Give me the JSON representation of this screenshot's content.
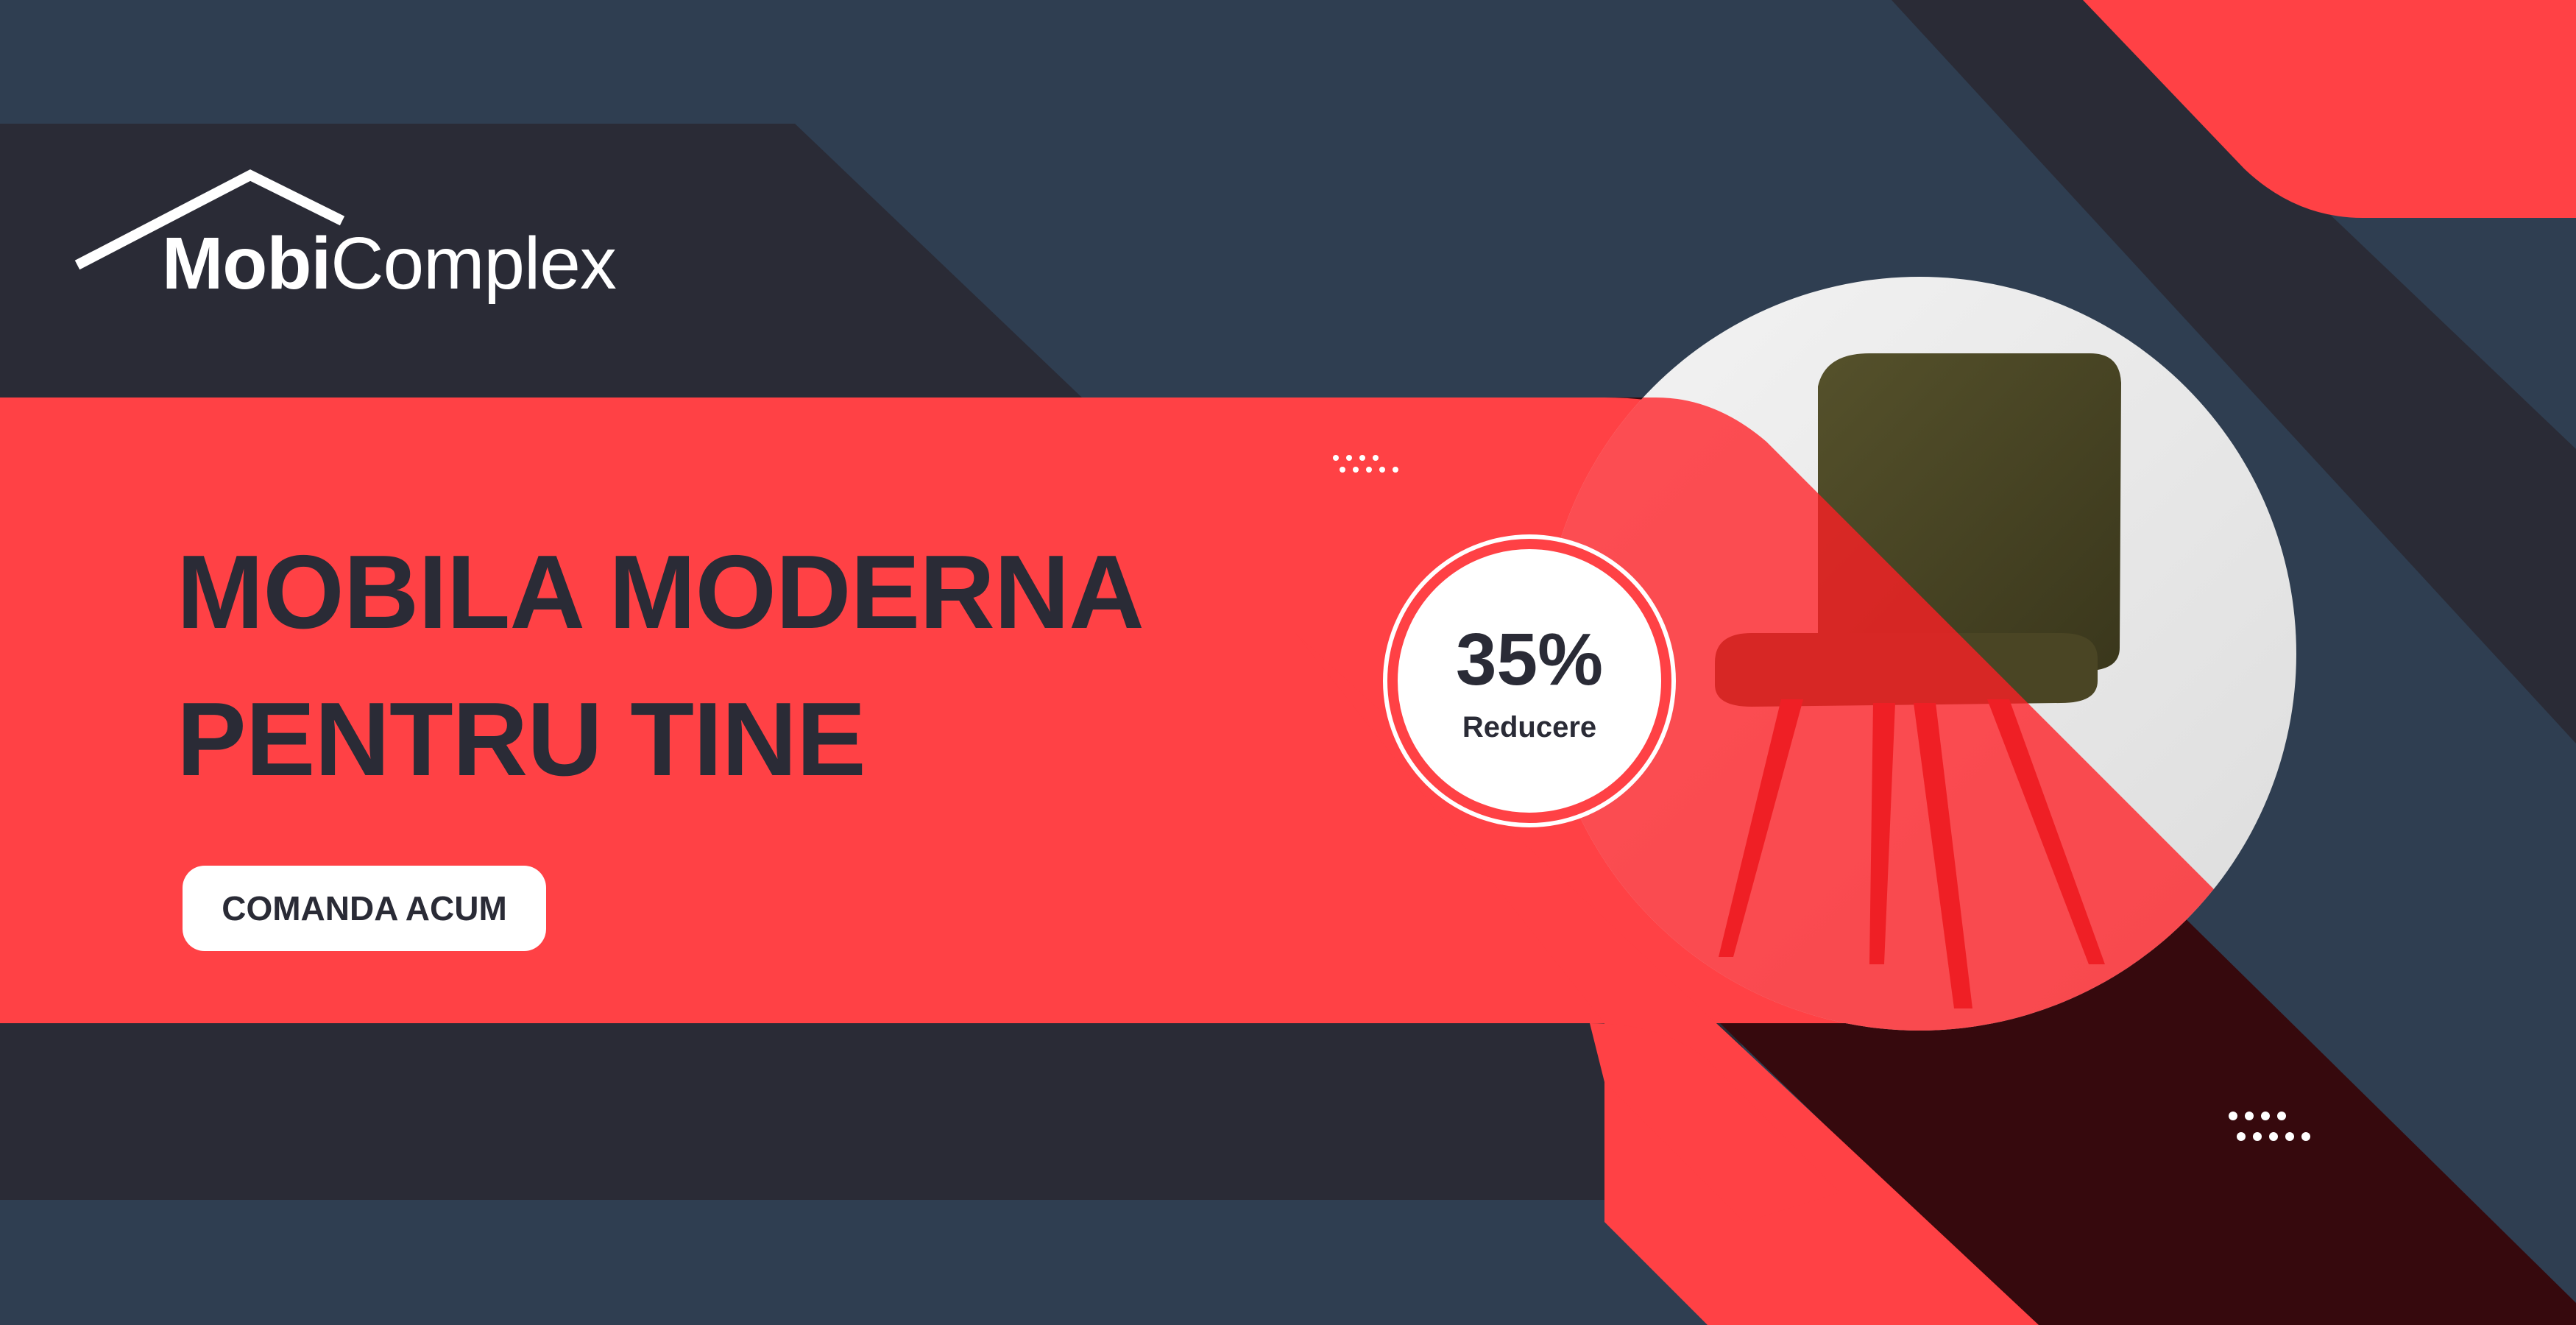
{
  "brand": {
    "name_bold": "Mobi",
    "name_light": "Complex"
  },
  "headline": {
    "line1": "MOBILA MODERNA",
    "line2": "PENTRU TINE"
  },
  "cta": {
    "label": "COMANDA ACUM"
  },
  "discount_badge": {
    "value": "35%",
    "label": "Reducere"
  },
  "colors": {
    "navy": "#2f3e51",
    "dark": "#2a2b36",
    "red": "#ff4145",
    "maroon": "#36090d",
    "white": "#ffffff"
  },
  "icons": [
    "house-roof-icon",
    "chair-image",
    "dot-grid-decoration"
  ]
}
